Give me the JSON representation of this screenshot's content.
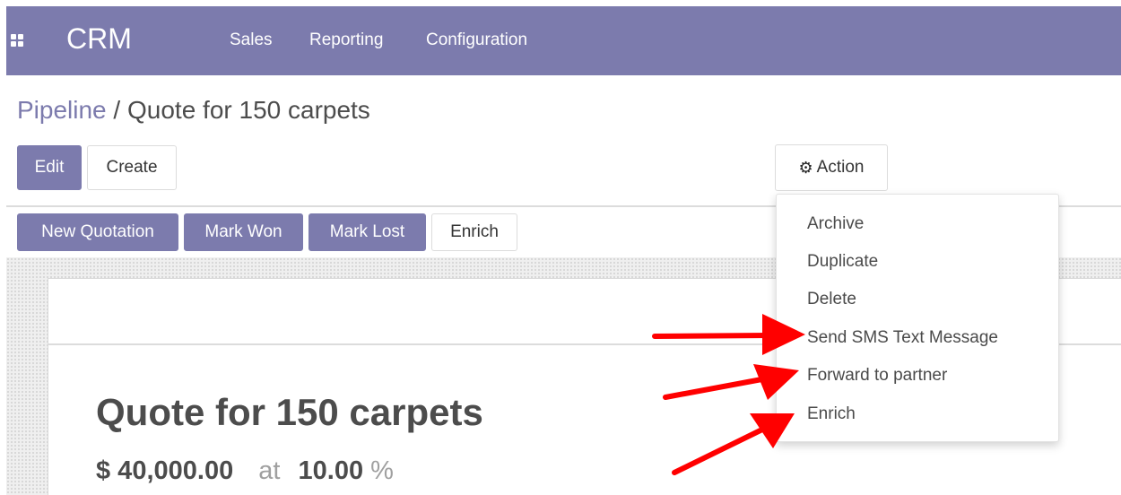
{
  "app": {
    "name": "CRM"
  },
  "nav": [
    {
      "label": "Sales"
    },
    {
      "label": "Reporting"
    },
    {
      "label": "Configuration"
    }
  ],
  "breadcrumb": {
    "parent": "Pipeline",
    "separator": "/",
    "current": "Quote for 150 carpets"
  },
  "toolbar": {
    "edit_label": "Edit",
    "create_label": "Create",
    "action_label": "Action",
    "action_icon": "gear-icon"
  },
  "status_buttons": [
    {
      "label": "New Quotation"
    },
    {
      "label": "Mark Won"
    },
    {
      "label": "Mark Lost"
    },
    {
      "label": "Enrich"
    }
  ],
  "action_menu": [
    {
      "label": "Archive"
    },
    {
      "label": "Duplicate"
    },
    {
      "label": "Delete"
    },
    {
      "label": "Send SMS Text Message"
    },
    {
      "label": "Forward to partner"
    },
    {
      "label": "Enrich"
    }
  ],
  "record": {
    "title": "Quote for 150 carpets",
    "amount": "$ 40,000.00",
    "at": "at",
    "probability": "10.00",
    "percent": "%"
  },
  "colors": {
    "brand": "#7c7bad",
    "annotation": "#ff0000"
  }
}
